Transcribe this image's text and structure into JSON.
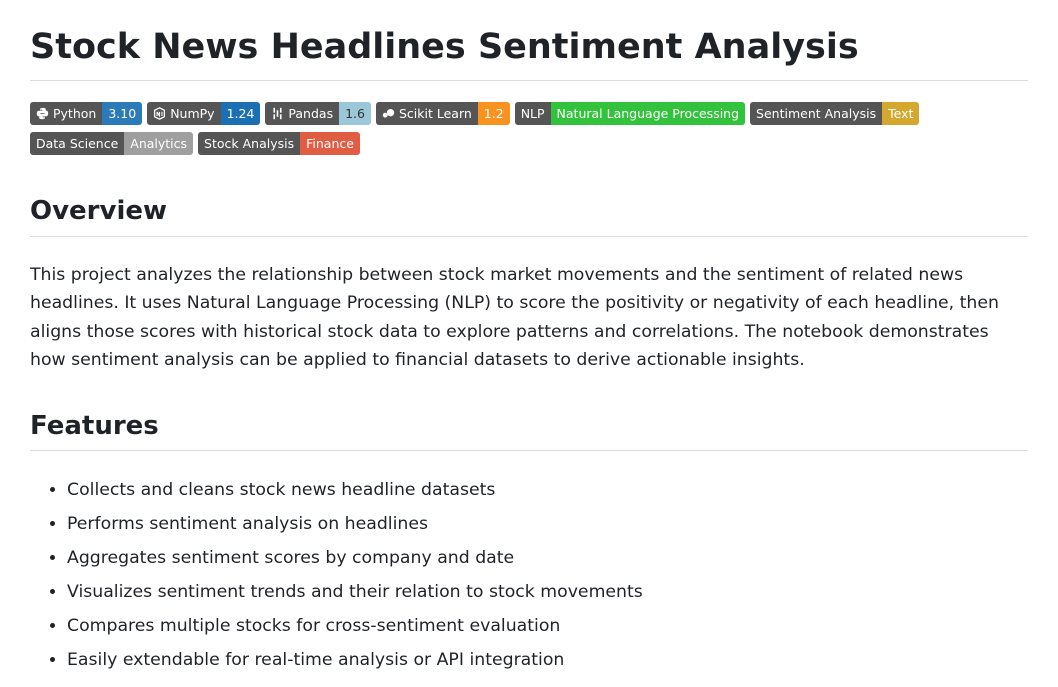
{
  "title": "Stock News Headlines Sentiment Analysis",
  "badges_row1": [
    {
      "icon": "python-icon",
      "left": "Python",
      "right": "3.10",
      "color": "#2b7bb9"
    },
    {
      "icon": "numpy-icon",
      "left": "NumPy",
      "right": "1.24",
      "color": "#1b6fb3"
    },
    {
      "icon": "pandas-icon",
      "left": "Pandas",
      "right": "1.6",
      "color": "#9cc7d9",
      "rightText": "#333333"
    },
    {
      "icon": "scikit-learn-icon",
      "left": "Scikit Learn",
      "right": "1.2",
      "color": "#f7931e"
    },
    {
      "icon": "",
      "left": "NLP",
      "right": "Natural Language Processing",
      "color": "#33c23c"
    },
    {
      "icon": "",
      "left": "Sentiment Analysis",
      "right": "Text",
      "color": "#d4a82e"
    }
  ],
  "badges_row2": [
    {
      "left": "Data Science",
      "right": "Analytics",
      "color": "#9f9f9f"
    },
    {
      "left": "Stock Analysis",
      "right": "Finance",
      "color": "#e05d44"
    }
  ],
  "overview": {
    "heading": "Overview",
    "text": "This project analyzes the relationship between stock market movements and the sentiment of related news headlines. It uses Natural Language Processing (NLP) to score the positivity or negativity of each headline, then aligns those scores with historical stock data to explore patterns and correlations. The notebook demonstrates how sentiment analysis can be applied to financial datasets to derive actionable insights."
  },
  "features": {
    "heading": "Features",
    "items": [
      "Collects and cleans stock news headline datasets",
      "Performs sentiment analysis on headlines",
      "Aggregates sentiment scores by company and date",
      "Visualizes sentiment trends and their relation to stock movements",
      "Compares multiple stocks for cross-sentiment evaluation",
      "Easily extendable for real-time analysis or API integration"
    ]
  }
}
